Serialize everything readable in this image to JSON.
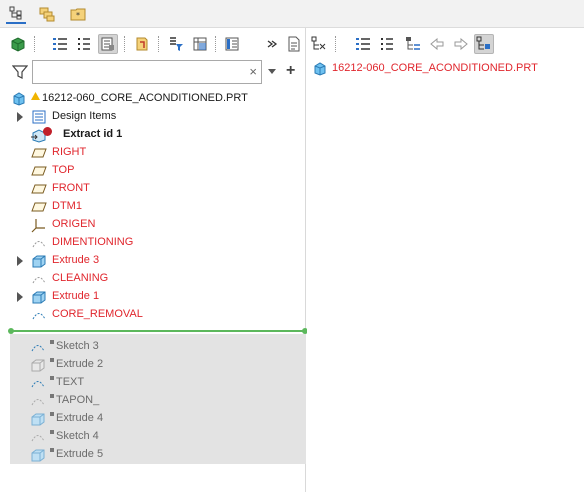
{
  "tabs": [
    {
      "name": "model-tree-tab",
      "active": true
    },
    {
      "name": "folder-browser-tab",
      "active": false
    },
    {
      "name": "favorites-tab",
      "active": false
    }
  ],
  "filter": {
    "placeholder": "",
    "value": "",
    "clear_glyph": "×",
    "add_glyph": "+"
  },
  "tree": {
    "root_label": "16212-060_CORE_ACONDITIONED.PRT",
    "rows": [
      {
        "label": "Design Items",
        "style": "normal",
        "expandable": true,
        "icon": "design-items-icon"
      },
      {
        "label": "Extract id 1",
        "style": "bold",
        "expandable": false,
        "icon": "extract-icon"
      },
      {
        "label": "RIGHT",
        "style": "red",
        "expandable": false,
        "icon": "datum-plane-icon"
      },
      {
        "label": "TOP",
        "style": "red",
        "expandable": false,
        "icon": "datum-plane-icon"
      },
      {
        "label": "FRONT",
        "style": "red",
        "expandable": false,
        "icon": "datum-plane-icon"
      },
      {
        "label": "DTM1",
        "style": "red",
        "expandable": false,
        "icon": "datum-plane-icon"
      },
      {
        "label": "ORIGEN",
        "style": "red",
        "expandable": false,
        "icon": "coordinate-system-icon"
      },
      {
        "label": "DIMENTIONING",
        "style": "red",
        "expandable": false,
        "icon": "sketch-icon"
      },
      {
        "label": "Extrude 3",
        "style": "red",
        "expandable": true,
        "icon": "extrude-icon"
      },
      {
        "label": "CLEANING",
        "style": "red",
        "expandable": false,
        "icon": "sketch-icon"
      },
      {
        "label": "Extrude 1",
        "style": "red",
        "expandable": true,
        "icon": "extrude-icon"
      },
      {
        "label": "CORE_REMOVAL",
        "style": "red",
        "expandable": false,
        "icon": "sketch-icon"
      }
    ],
    "suppressed_rows": [
      {
        "label": "Sketch 3",
        "icon": "sketch-icon"
      },
      {
        "label": "Extrude 2",
        "icon": "extrude-icon"
      },
      {
        "label": "TEXT",
        "icon": "sketch-icon"
      },
      {
        "label": "TAPON_",
        "icon": "sketch-icon"
      },
      {
        "label": "Extrude 4",
        "icon": "extrude-icon"
      },
      {
        "label": "Sketch 4",
        "icon": "sketch-icon"
      },
      {
        "label": "Extrude 5",
        "icon": "extrude-icon"
      }
    ]
  },
  "right_panel": {
    "item_label": "16212-060_CORE_ACONDITIONED.PRT"
  },
  "colors": {
    "failed_red": "#e0262d",
    "insert_line": "#5cb85c",
    "suppressed_bg": "#e3e3e3"
  }
}
